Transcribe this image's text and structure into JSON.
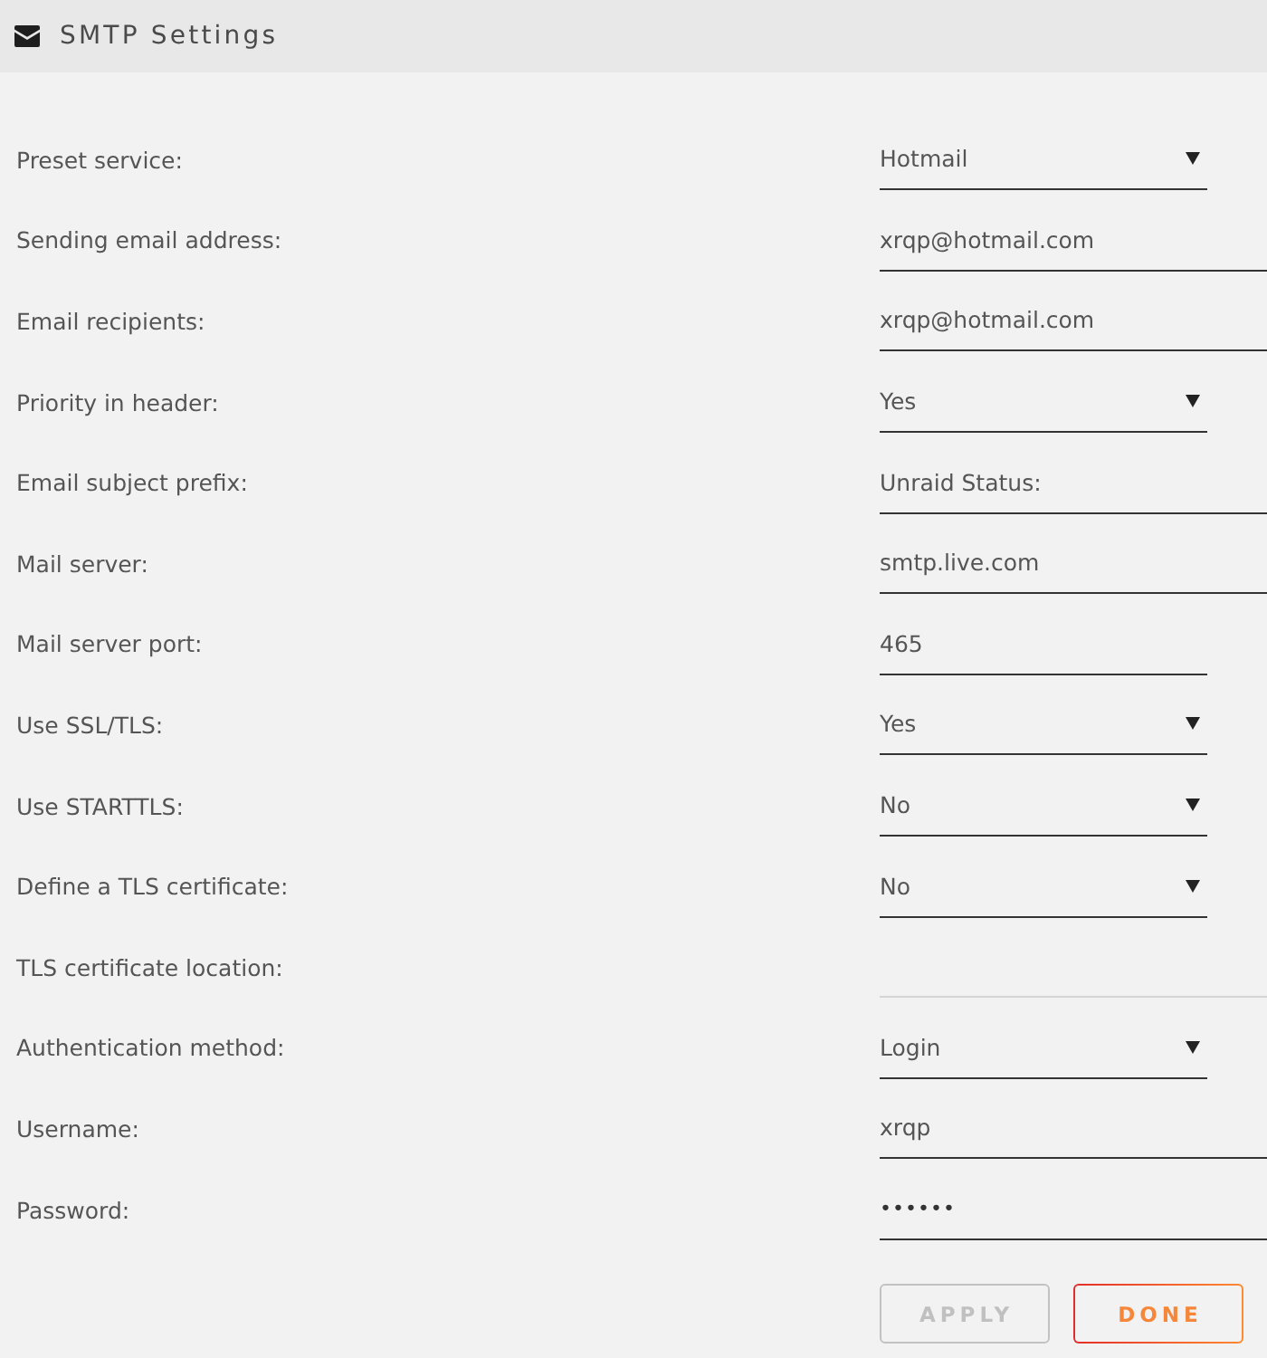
{
  "header": {
    "title": "SMTP Settings"
  },
  "fields": [
    {
      "label": "Preset service:",
      "kind": "select",
      "value": "Hotmail",
      "disabled": false
    },
    {
      "label": "Sending email address:",
      "kind": "text",
      "value": "xrqp@hotmail.com",
      "disabled": false
    },
    {
      "label": "Email recipients:",
      "kind": "text",
      "value": "xrqp@hotmail.com",
      "disabled": false
    },
    {
      "label": "Priority in header:",
      "kind": "select",
      "value": "Yes",
      "disabled": false
    },
    {
      "label": "Email subject prefix:",
      "kind": "text",
      "value": "Unraid Status:",
      "disabled": false
    },
    {
      "label": "Mail server:",
      "kind": "text",
      "value": "smtp.live.com",
      "disabled": false
    },
    {
      "label": "Mail server port:",
      "kind": "short",
      "value": "465",
      "disabled": false
    },
    {
      "label": "Use SSL/TLS:",
      "kind": "select",
      "value": "Yes",
      "disabled": false
    },
    {
      "label": "Use STARTTLS:",
      "kind": "select",
      "value": "No",
      "disabled": false
    },
    {
      "label": "Define a TLS certificate:",
      "kind": "select",
      "value": "No",
      "disabled": false
    },
    {
      "label": "TLS certificate location:",
      "kind": "text",
      "disabled": true
    },
    {
      "label": "Authentication method:",
      "kind": "select",
      "value": "Login",
      "disabled": false
    },
    {
      "label": "Username:",
      "kind": "text",
      "value": "xrqp",
      "disabled": false
    },
    {
      "label": "Password:",
      "kind": "password",
      "value": "••••••",
      "disabled": false
    }
  ],
  "buttons": [
    {
      "label": "APPLY",
      "disabled": true
    },
    {
      "label": "DONE",
      "disabled": false
    }
  ]
}
